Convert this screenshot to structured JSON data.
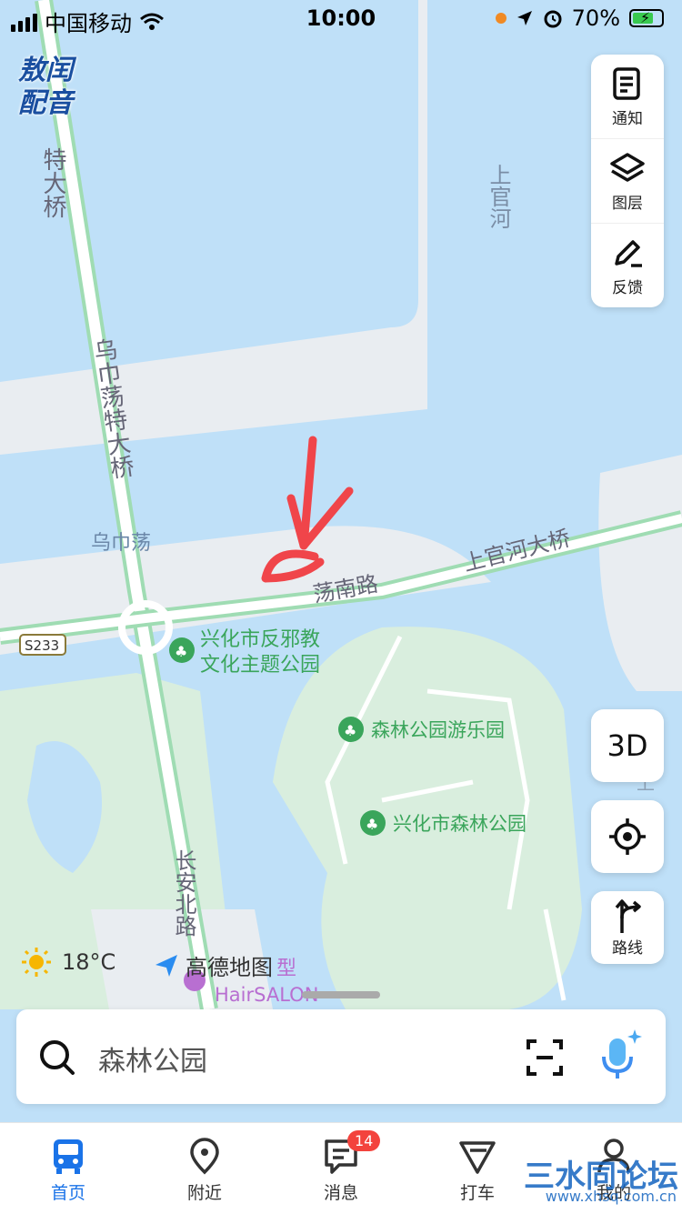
{
  "status_bar": {
    "carrier": "中国移动",
    "time": "10:00",
    "battery_percent": "70%"
  },
  "brand_badge": {
    "line1": "敖闰",
    "line2": "配音"
  },
  "map_labels": {
    "bridge_vertical_1": "特大桥",
    "bridge_vertical_2": "乌巾荡特大桥",
    "river_label": "上官河",
    "lake_label": "乌巾荡",
    "road_dangnan": "荡南路",
    "bridge_shangguan": "上官河大桥",
    "highway_code": "S233",
    "poi_park_1_line1": "兴化市反邪教",
    "poi_park_1_line2": "文化主题公园",
    "poi_amusement": "森林公园游乐园",
    "poi_forest_park": "兴化市森林公园",
    "road_changan": "长安北路",
    "poi_hair": "HairSALON",
    "poi_hair_prefix": "型",
    "edge_glyph": "上"
  },
  "side_panel": {
    "notice": "通知",
    "layers": "图层",
    "feedback": "反馈"
  },
  "controls": {
    "btn_3d": "3D",
    "route": "路线"
  },
  "weather": {
    "temp": "18°C"
  },
  "amap_logo": "高德地图",
  "search": {
    "placeholder": "森林公园"
  },
  "tabs": [
    {
      "label": "首页"
    },
    {
      "label": "附近"
    },
    {
      "label": "消息",
      "badge": "14"
    },
    {
      "label": "打车"
    },
    {
      "label": "我的"
    }
  ],
  "watermark": {
    "text": "三水同论坛",
    "sub": "www.xhsq.com.cn"
  },
  "colors": {
    "water": "#bfe0f8",
    "land": "#eef0f2",
    "park": "#d9eede",
    "road": "#ffffff",
    "road_edge": "#9fdcb3",
    "accent_blue": "#1a73e8",
    "annotation_red": "#f0454a",
    "poi_green": "#3aa55b"
  }
}
